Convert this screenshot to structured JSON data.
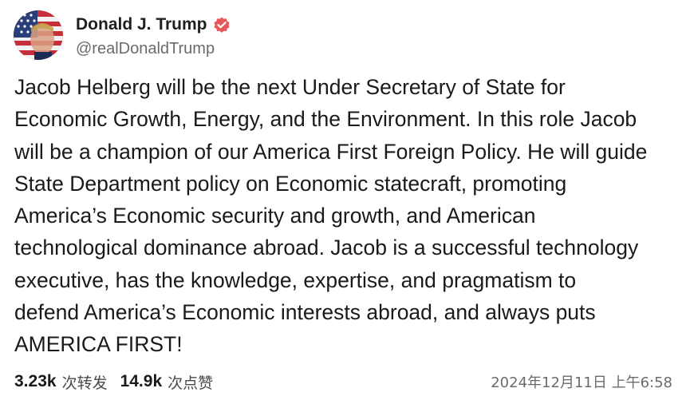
{
  "author": {
    "display_name": "Donald J. Trump",
    "handle": "@realDonaldTrump",
    "verified_icon": "verified-badge-icon",
    "verified_color": "#e8585a"
  },
  "post": {
    "text": "Jacob Helberg will be the next Under Secretary of State for\nEconomic Growth, Energy, and the Environment. In this role Jacob\nwill be a champion of our America First Foreign Policy. He will guide\nState Department policy on Economic statecraft, promoting\nAmerica’s Economic security and growth, and American\ntechnological dominance abroad. Jacob is a successful technology\nexecutive, has the knowledge, expertise, and pragmatism to\ndefend America’s Economic interests abroad, and always puts\nAMERICA FIRST!"
  },
  "stats": {
    "reposts_count": "3.23k",
    "reposts_label": "次转发",
    "likes_count": "14.9k",
    "likes_label": "次点赞"
  },
  "timestamp": "2024年12月11日 上午6:58"
}
